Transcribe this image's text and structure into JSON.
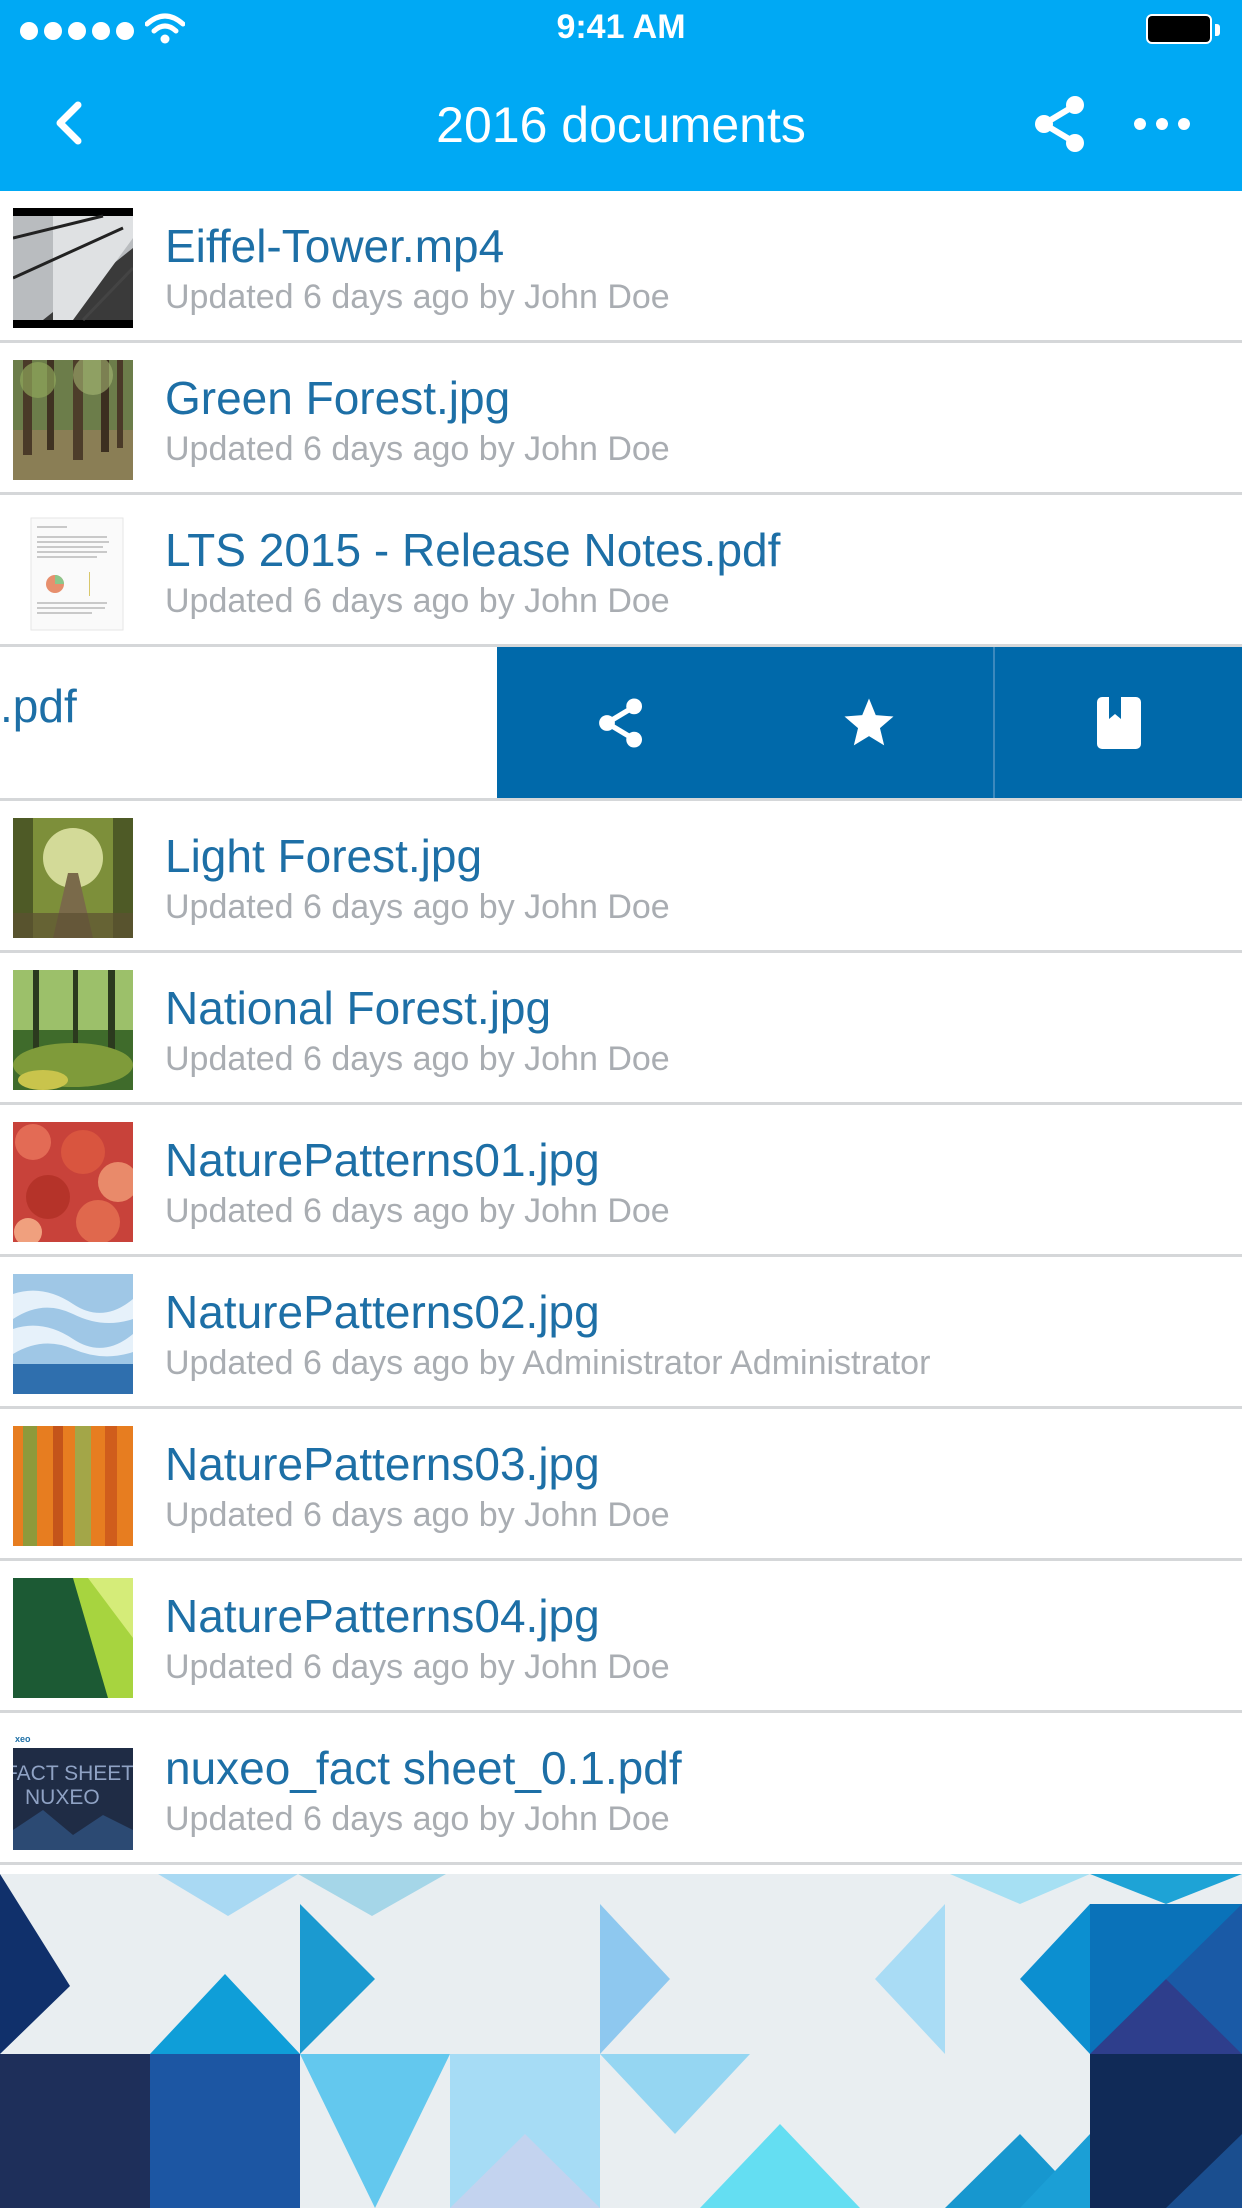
{
  "status_bar": {
    "time": "9:41 AM"
  },
  "nav": {
    "title": "2016 documents",
    "back": "back",
    "share": "share",
    "more": "more"
  },
  "documents": [
    {
      "name": "Eiffel-Tower.mp4",
      "meta": "Updated 6 days ago by John Doe"
    },
    {
      "name": "Green Forest.jpg",
      "meta": "Updated 6 days ago by John Doe"
    },
    {
      "name": "LTS 2015 - Release Notes.pdf",
      "meta": "Updated 6 days ago by John Doe"
    }
  ],
  "swiped_item": {
    "name_fragment": ".pdf"
  },
  "swipe_actions": [
    "share-icon",
    "star-icon",
    "bookmark-icon"
  ],
  "documents_after": [
    {
      "name": "Light Forest.jpg",
      "meta": "Updated 6 days ago by John Doe"
    },
    {
      "name": "National Forest.jpg",
      "meta": "Updated 6 days ago by John Doe"
    },
    {
      "name": "NaturePatterns01.jpg",
      "meta": "Updated 6 days ago by John Doe"
    },
    {
      "name": "NaturePatterns02.jpg",
      "meta": "Updated 6 days ago by Administrator Administrator"
    },
    {
      "name": "NaturePatterns03.jpg",
      "meta": "Updated 6 days ago by John Doe"
    },
    {
      "name": "NaturePatterns04.jpg",
      "meta": "Updated 6 days ago by John Doe"
    },
    {
      "name": "nuxeo_fact sheet_0.1.pdf",
      "meta": "Updated 6 days ago by John Doe"
    }
  ],
  "thumb_texts": {
    "fact_sheet_line1": "FACT SHEET",
    "fact_sheet_line2": "NUXEO",
    "fact_sheet_logo": "xeo"
  },
  "colors": {
    "nav_bg": "#00a9f4",
    "accent": "#1d6fa6",
    "action_bg": "#0069aa",
    "meta": "#a9adb2"
  }
}
